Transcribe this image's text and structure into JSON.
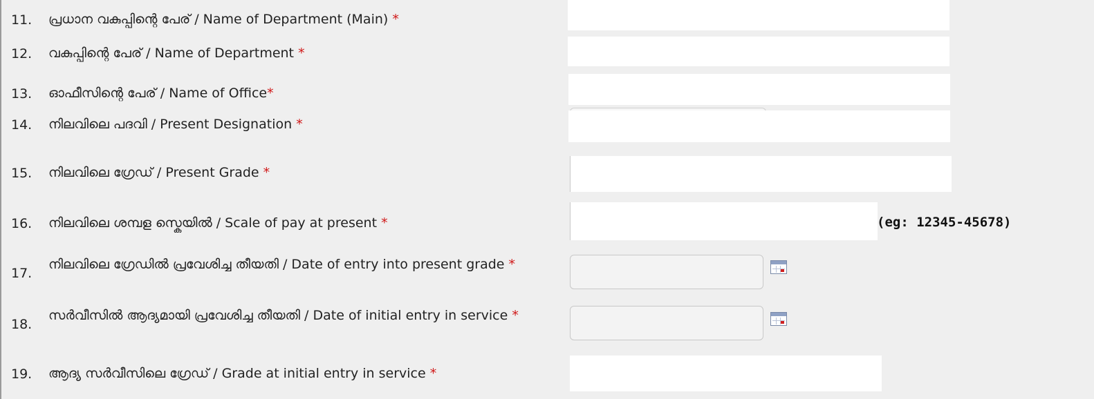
{
  "form": {
    "rows": [
      {
        "num": "11.",
        "label": "പ്രധാന വകുപ്പിന്റെ പേര് / Name of Department (Main)",
        "req": "*",
        "value": ""
      },
      {
        "num": "12.",
        "label": "വകുപ്പിന്റെ പേര് / Name of Department",
        "req": "*",
        "value": ""
      },
      {
        "num": "13.",
        "label": "ഓഫീസിന്റെ പേര് / Name of Office",
        "req": "*",
        "value": ""
      },
      {
        "num": "14.",
        "label": "നിലവിലെ പദവി / Present Designation",
        "req": "*",
        "value": ""
      },
      {
        "num": "15.",
        "label": "നിലവിലെ ഗ്രേഡ് / Present Grade",
        "req": "*",
        "value": ""
      },
      {
        "num": "16.",
        "label": "നിലവിലെ ശമ്പള സ്കെയിൽ / Scale of pay at present",
        "req": "*",
        "value": "",
        "hint": "(eg: 12345-45678)"
      },
      {
        "num": "17.",
        "label": "നിലവിലെ ഗ്രേഡിൽ പ്രവേശിച്ച തീയതി / Date of entry into present grade",
        "req": "*",
        "value": ""
      },
      {
        "num": "18.",
        "label": "സർവീസിൽ ആദ്യമായി പ്രവേശിച്ച തീയതി / Date of initial entry in service",
        "req": "*",
        "value": ""
      },
      {
        "num": "19.",
        "label": "ആദ്യ സർവീസിലെ ഗ്രേഡ് / Grade at initial entry in service",
        "req": "*",
        "value": ""
      }
    ]
  },
  "colors": {
    "required": "#d01818",
    "background": "#efefef"
  },
  "icons": {
    "date_picker": "calendar-icon"
  }
}
